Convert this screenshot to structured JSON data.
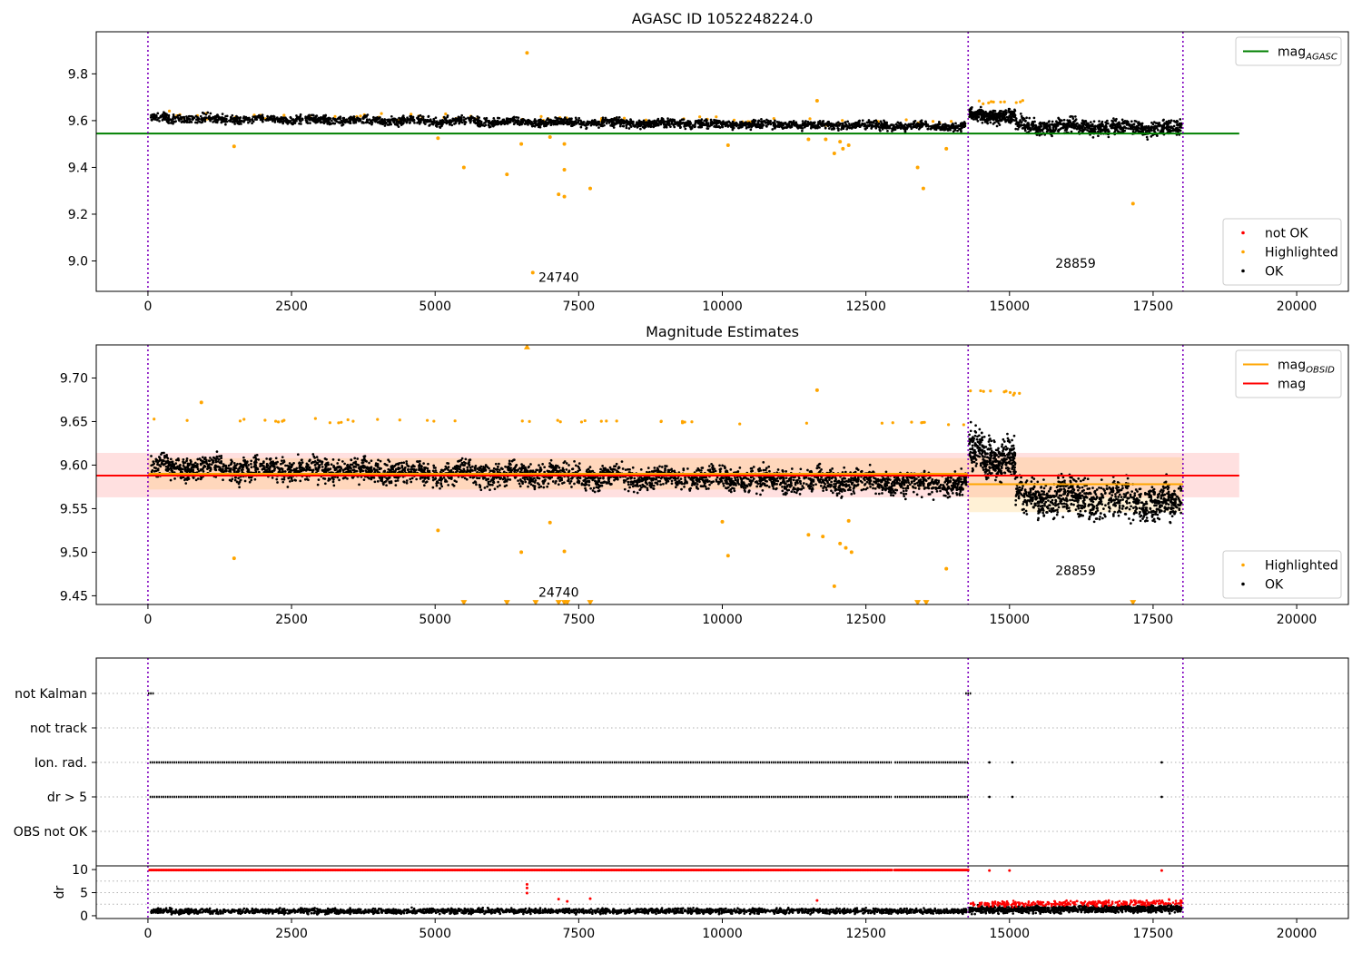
{
  "chart_data": [
    {
      "type": "scatter",
      "title": "AGASC ID 1052248224.0",
      "xlim": [
        -900,
        20900
      ],
      "ylim": [
        8.87,
        9.98
      ],
      "x_ticks": [
        0,
        2500,
        5000,
        7500,
        10000,
        12500,
        15000,
        17500,
        20000
      ],
      "y_ticks": [
        9.0,
        9.2,
        9.4,
        9.6,
        9.8
      ],
      "y_tick_labels": [
        "9.0",
        "9.2",
        "9.4",
        "9.6",
        "9.8"
      ],
      "obs_boundaries": [
        0,
        14280,
        18020
      ],
      "obs_labels": [
        {
          "text": "24740",
          "x": 7150,
          "y": 8.91
        },
        {
          "text": "28859",
          "x": 16150,
          "y": 8.97
        }
      ],
      "lines": [
        {
          "name": "mag",
          "sub": "AGASC",
          "color": "#008000",
          "x": [
            -900,
            19000
          ],
          "y": [
            9.545,
            9.545
          ]
        }
      ],
      "series": [
        {
          "name": "not OK",
          "color": "#ff0000",
          "segments": []
        },
        {
          "name": "Highlighted",
          "color": "#ffa500",
          "segments": [
            {
              "x0": 50,
              "x1": 14250,
              "y_start": 9.625,
              "y_end": 9.595,
              "spread": 0.03,
              "count": 60,
              "seed": 11
            },
            {
              "x0": 14300,
              "x1": 15300,
              "y_start": 9.68,
              "y_end": 9.68,
              "spread": 0.015,
              "count": 10,
              "seed": 12
            }
          ],
          "points": [
            {
              "x": 6600,
              "y": 9.89
            },
            {
              "x": 1500,
              "y": 9.49
            },
            {
              "x": 5500,
              "y": 9.4
            },
            {
              "x": 6250,
              "y": 9.37
            },
            {
              "x": 6700,
              "y": 8.95
            },
            {
              "x": 7150,
              "y": 9.285
            },
            {
              "x": 7250,
              "y": 9.275
            },
            {
              "x": 7250,
              "y": 9.39
            },
            {
              "x": 7700,
              "y": 9.31
            },
            {
              "x": 7250,
              "y": 9.5
            },
            {
              "x": 6500,
              "y": 9.5
            },
            {
              "x": 7000,
              "y": 9.53
            },
            {
              "x": 5050,
              "y": 9.525
            },
            {
              "x": 10100,
              "y": 9.495
            },
            {
              "x": 11650,
              "y": 9.685
            },
            {
              "x": 11950,
              "y": 9.46
            },
            {
              "x": 12100,
              "y": 9.48
            },
            {
              "x": 12050,
              "y": 9.51
            },
            {
              "x": 12200,
              "y": 9.495
            },
            {
              "x": 11500,
              "y": 9.52
            },
            {
              "x": 11800,
              "y": 9.52
            },
            {
              "x": 13400,
              "y": 9.4
            },
            {
              "x": 13500,
              "y": 9.31
            },
            {
              "x": 13900,
              "y": 9.48
            },
            {
              "x": 17150,
              "y": 9.245
            }
          ]
        },
        {
          "name": "OK",
          "color": "#000000",
          "segments": [
            {
              "x0": 50,
              "x1": 14250,
              "y_start": 9.61,
              "y_end": 9.575,
              "spread": 0.035,
              "count": 2600,
              "seed": 21
            },
            {
              "x0": 14300,
              "x1": 15100,
              "y_start": 9.625,
              "y_end": 9.62,
              "spread": 0.055,
              "count": 320,
              "seed": 22
            },
            {
              "x0": 15100,
              "x1": 18000,
              "y_start": 9.58,
              "y_end": 9.565,
              "spread": 0.06,
              "count": 760,
              "seed": 23
            }
          ]
        }
      ],
      "legends": [
        {
          "position": "upper-right",
          "entries": [
            {
              "name": "mag",
              "sub": "AGASC",
              "kind": "line",
              "color": "#008000"
            }
          ]
        },
        {
          "position": "lower-right",
          "entries": [
            {
              "name": "not OK",
              "kind": "dot",
              "color": "#ff0000"
            },
            {
              "name": "Highlighted",
              "kind": "dot",
              "color": "#ffa500"
            },
            {
              "name": "OK",
              "kind": "dot",
              "color": "#000000"
            }
          ]
        }
      ]
    },
    {
      "type": "scatter",
      "title": "Magnitude Estimates",
      "xlim": [
        -900,
        20900
      ],
      "ylim": [
        9.44,
        9.738
      ],
      "x_ticks": [
        0,
        2500,
        5000,
        7500,
        10000,
        12500,
        15000,
        17500,
        20000
      ],
      "y_ticks": [
        9.45,
        9.5,
        9.55,
        9.6,
        9.65,
        9.7
      ],
      "y_tick_labels": [
        "9.45",
        "9.50",
        "9.55",
        "9.60",
        "9.65",
        "9.70"
      ],
      "obs_boundaries": [
        0,
        14280,
        18020
      ],
      "obs_labels": [
        {
          "text": "24740",
          "x": 7150,
          "y": 9.449
        },
        {
          "text": "28859",
          "x": 16150,
          "y": 9.474
        }
      ],
      "bands": [
        {
          "x0": -900,
          "x1": 19000,
          "y0": 9.563,
          "y1": 9.614,
          "color": "#ff0000",
          "opacity": 0.12
        },
        {
          "x0": 0,
          "x1": 14280,
          "y0": 9.572,
          "y1": 9.608,
          "color": "#ffa500",
          "opacity": 0.16
        },
        {
          "x0": 14280,
          "x1": 18020,
          "y0": 9.546,
          "y1": 9.609,
          "color": "#ffa500",
          "opacity": 0.16
        }
      ],
      "lines": [
        {
          "name": "mag",
          "sub": "OBSID",
          "color": "#ffa500",
          "x": [
            0,
            14280
          ],
          "y": [
            9.59,
            9.59
          ]
        },
        {
          "name": "mag",
          "sub": "OBSID",
          "color": "#ffa500",
          "x": [
            14280,
            18020
          ],
          "y": [
            9.578,
            9.578
          ]
        },
        {
          "name": "mag",
          "color": "#ff0000",
          "x": [
            -900,
            19000
          ],
          "y": [
            9.588,
            9.588
          ]
        }
      ],
      "series": [
        {
          "name": "Highlighted",
          "color": "#ffa500",
          "segments": [
            {
              "x0": 50,
              "x1": 14250,
              "y_start": 9.652,
              "y_end": 9.648,
              "spread": 0.004,
              "count": 45,
              "seed": 31
            },
            {
              "x0": 14300,
              "x1": 15300,
              "y_start": 9.685,
              "y_end": 9.682,
              "spread": 0.006,
              "count": 10,
              "seed": 32
            }
          ],
          "points": [
            {
              "x": 930,
              "y": 9.672
            },
            {
              "x": 1500,
              "y": 9.493
            },
            {
              "x": 5050,
              "y": 9.525
            },
            {
              "x": 6500,
              "y": 9.5
            },
            {
              "x": 7000,
              "y": 9.534
            },
            {
              "x": 7250,
              "y": 9.501
            },
            {
              "x": 10000,
              "y": 9.535
            },
            {
              "x": 10100,
              "y": 9.496
            },
            {
              "x": 11500,
              "y": 9.52
            },
            {
              "x": 11650,
              "y": 9.686
            },
            {
              "x": 11750,
              "y": 9.518
            },
            {
              "x": 11950,
              "y": 9.461
            },
            {
              "x": 12050,
              "y": 9.51
            },
            {
              "x": 12150,
              "y": 9.505
            },
            {
              "x": 12250,
              "y": 9.5
            },
            {
              "x": 12200,
              "y": 9.536
            },
            {
              "x": 13900,
              "y": 9.481
            }
          ],
          "offscale": [
            {
              "x": 6600,
              "y": 9.736,
              "dir": "up"
            },
            {
              "x": 5500,
              "y": 9.442,
              "dir": "down"
            },
            {
              "x": 6250,
              "y": 9.442,
              "dir": "down"
            },
            {
              "x": 6750,
              "y": 9.442,
              "dir": "down"
            },
            {
              "x": 7150,
              "y": 9.442,
              "dir": "down"
            },
            {
              "x": 7250,
              "y": 9.442,
              "dir": "down"
            },
            {
              "x": 7300,
              "y": 9.442,
              "dir": "down"
            },
            {
              "x": 7700,
              "y": 9.442,
              "dir": "down"
            },
            {
              "x": 13400,
              "y": 9.442,
              "dir": "down"
            },
            {
              "x": 13550,
              "y": 9.442,
              "dir": "down"
            },
            {
              "x": 17150,
              "y": 9.442,
              "dir": "down"
            }
          ]
        },
        {
          "name": "OK",
          "color": "#000000",
          "segments": [
            {
              "x0": 50,
              "x1": 14250,
              "y_start": 9.598,
              "y_end": 9.578,
              "spread": 0.025,
              "count": 3400,
              "seed": 41
            },
            {
              "x0": 14300,
              "x1": 15100,
              "y_start": 9.615,
              "y_end": 9.605,
              "spread": 0.045,
              "count": 380,
              "seed": 42
            },
            {
              "x0": 15100,
              "x1": 18000,
              "y_start": 9.565,
              "y_end": 9.555,
              "spread": 0.04,
              "count": 900,
              "seed": 43
            }
          ]
        }
      ],
      "legends": [
        {
          "position": "upper-right",
          "entries": [
            {
              "name": "mag",
              "sub": "OBSID",
              "kind": "line",
              "color": "#ffa500"
            },
            {
              "name": "mag",
              "kind": "line",
              "color": "#ff0000"
            }
          ]
        },
        {
          "position": "lower-right",
          "entries": [
            {
              "name": "Highlighted",
              "kind": "dot",
              "color": "#ffa500"
            },
            {
              "name": "OK",
              "kind": "dot",
              "color": "#000000"
            }
          ]
        }
      ]
    },
    {
      "type": "scatter",
      "xlim": [
        -900,
        20900
      ],
      "categories": [
        "not Kalman",
        "not track",
        "Ion. rad.",
        "dr > 5",
        "OBS not OK"
      ],
      "obs_boundaries": [
        0,
        14280,
        18020
      ],
      "flag_series": [
        {
          "category": "not Kalman",
          "ranges": [
            [
              0,
              100
            ],
            [
              14230,
              14330
            ]
          ],
          "points": []
        },
        {
          "category": "not track",
          "ranges": [],
          "points": []
        },
        {
          "category": "Ion. rad.",
          "ranges": [
            [
              30,
              12950
            ],
            [
              13000,
              14280
            ]
          ],
          "points": [
            14650,
            15050,
            17650
          ]
        },
        {
          "category": "dr > 5",
          "ranges": [
            [
              30,
              12950
            ],
            [
              13000,
              14280
            ]
          ],
          "points": [
            14650,
            15050,
            17650
          ]
        },
        {
          "category": "OBS not OK",
          "ranges": [],
          "points": []
        }
      ]
    },
    {
      "type": "scatter",
      "ylabel": "dr",
      "xlim": [
        -900,
        20900
      ],
      "ylim": [
        -0.6,
        10.8
      ],
      "x_ticks": [
        0,
        2500,
        5000,
        7500,
        10000,
        12500,
        15000,
        17500,
        20000
      ],
      "x_tick_labels": [
        "0",
        "2500",
        "5000",
        "7500",
        "10000",
        "12500",
        "15000",
        "17500",
        "20000"
      ],
      "y_ticks": [
        0,
        5,
        10
      ],
      "y_tick_labels": [
        "0",
        "5",
        "10"
      ],
      "obs_boundaries": [
        0,
        14280,
        18020
      ],
      "series": [
        {
          "name": "dr",
          "color": "#000000",
          "segments": [
            {
              "x0": 50,
              "x1": 14250,
              "y_start": 1.0,
              "y_end": 1.0,
              "spread": 0.8,
              "count": 2400,
              "seed": 51
            },
            {
              "x0": 14300,
              "x1": 18000,
              "y_start": 1.3,
              "y_end": 1.5,
              "spread": 1.1,
              "count": 1100,
              "seed": 52
            }
          ]
        },
        {
          "name": "dr > 5",
          "color": "#ff0000",
          "segments": [
            {
              "x0": 14300,
              "x1": 18000,
              "y_start": 2.5,
              "y_end": 2.9,
              "spread": 0.9,
              "count": 300,
              "seed": 53
            }
          ],
          "ranges": [
            {
              "x0": 30,
              "x1": 12950,
              "y": 9.9,
              "count": 520
            },
            {
              "x0": 13000,
              "x1": 14280,
              "y": 9.9,
              "count": 60
            }
          ],
          "points": [
            {
              "x": 6600,
              "y": 6.8
            },
            {
              "x": 6600,
              "y": 6.0
            },
            {
              "x": 6600,
              "y": 4.9
            },
            {
              "x": 7150,
              "y": 3.6
            },
            {
              "x": 7300,
              "y": 3.1
            },
            {
              "x": 7700,
              "y": 3.7
            },
            {
              "x": 11650,
              "y": 3.3
            },
            {
              "x": 14650,
              "y": 9.8
            },
            {
              "x": 15000,
              "y": 9.8
            },
            {
              "x": 17650,
              "y": 9.8
            }
          ]
        }
      ]
    }
  ]
}
